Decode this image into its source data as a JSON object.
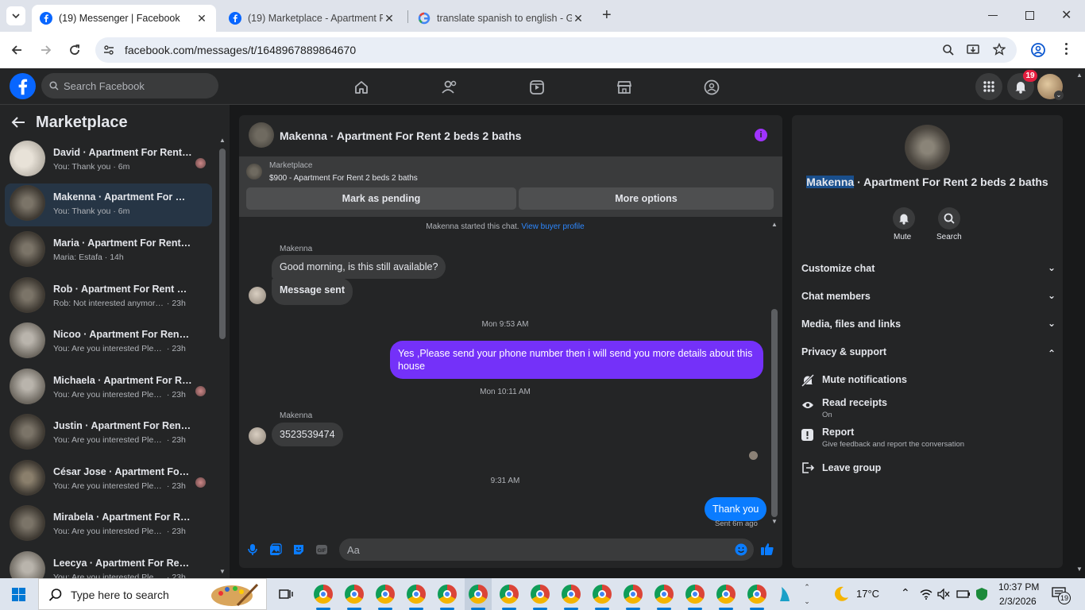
{
  "browser": {
    "tabs": [
      {
        "title": "(19) Messenger | Facebook",
        "active": true
      },
      {
        "title": "(19) Marketplace - Apartment F",
        "active": false
      },
      {
        "title": "translate spanish to english - G",
        "active": false
      }
    ],
    "url": "facebook.com/messages/t/1648967889864670"
  },
  "fb": {
    "search_placeholder": "Search Facebook",
    "notification_count": "19"
  },
  "sidebar": {
    "title": "Marketplace",
    "conversations": [
      {
        "name": "David · Apartment For Rent 2...",
        "preview": "You: Thank you",
        "time": "6m"
      },
      {
        "name": "Makenna · Apartment For Rent ...",
        "preview": "You: Thank you",
        "time": "6m"
      },
      {
        "name": "Maria · Apartment For Rent 2 b...",
        "preview": "Maria: Estafa",
        "time": "14h"
      },
      {
        "name": "Rob · Apartment For Rent 2 bed...",
        "preview": "Rob: Not interested anymore, but...",
        "time": "23h"
      },
      {
        "name": "Nicoo · Apartment For Rent 2 b...",
        "preview": "You: Are you interested Please se...",
        "time": "23h"
      },
      {
        "name": "Michaela · Apartment For Re...",
        "preview": "You: Are you interested Please ...",
        "time": "23h"
      },
      {
        "name": "Justin · Apartment For Rent 2 b...",
        "preview": "You: Are you interested Please se...",
        "time": "23h"
      },
      {
        "name": "César Jose · Apartment For R...",
        "preview": "You: Are you interested Please ...",
        "time": "23h"
      },
      {
        "name": "Mirabela · Apartment For Rent ...",
        "preview": "You: Are you interested Please se...",
        "time": "23h"
      },
      {
        "name": "Leecya · Apartment For Rent 2 ...",
        "preview": "You: Are you interested Please se...",
        "time": "23h"
      }
    ]
  },
  "chat": {
    "title": "Makenna · Apartment For Rent 2 beds 2 baths",
    "listing_label": "Marketplace",
    "listing_text": "$900 - Apartment For Rent 2 beds 2 baths",
    "mark_pending": "Mark as pending",
    "more_options": "More options",
    "started_text": "Makenna started this chat.",
    "view_buyer": "View buyer profile",
    "sender_name": "Makenna",
    "msg1": "Good morning, is this still available?",
    "msg2": "Message sent",
    "time1": "Mon 9:53 AM",
    "msg3": "Yes ,Please send your phone number then i will send you more details about this house",
    "time2": "Mon 10:11 AM",
    "msg4": "3523539474",
    "time3": "9:31 AM",
    "msg5": "Thank you",
    "sent_status": "Sent 6m ago",
    "input_placeholder": "Aa"
  },
  "info": {
    "name_highlight": "Makenna",
    "name_rest": " · Apartment For Rent 2 beds 2 baths",
    "mute": "Mute",
    "search": "Search",
    "sections": [
      "Customize chat",
      "Chat members",
      "Media, files and links",
      "Privacy & support"
    ],
    "mute_notifications": "Mute notifications",
    "read_receipts": "Read receipts",
    "read_receipts_state": "On",
    "report": "Report",
    "report_desc": "Give feedback and report the conversation",
    "leave_group": "Leave group"
  },
  "taskbar": {
    "search_placeholder": "Type here to search",
    "weather": "17°C",
    "time": "10:37 PM",
    "date": "2/3/2026",
    "notif_count": "19"
  },
  "colors": {
    "accent_purple": "#7431f9",
    "messenger_blue": "#0a7cff",
    "fb_blue": "#0866ff",
    "link_blue": "#2d88ff"
  }
}
